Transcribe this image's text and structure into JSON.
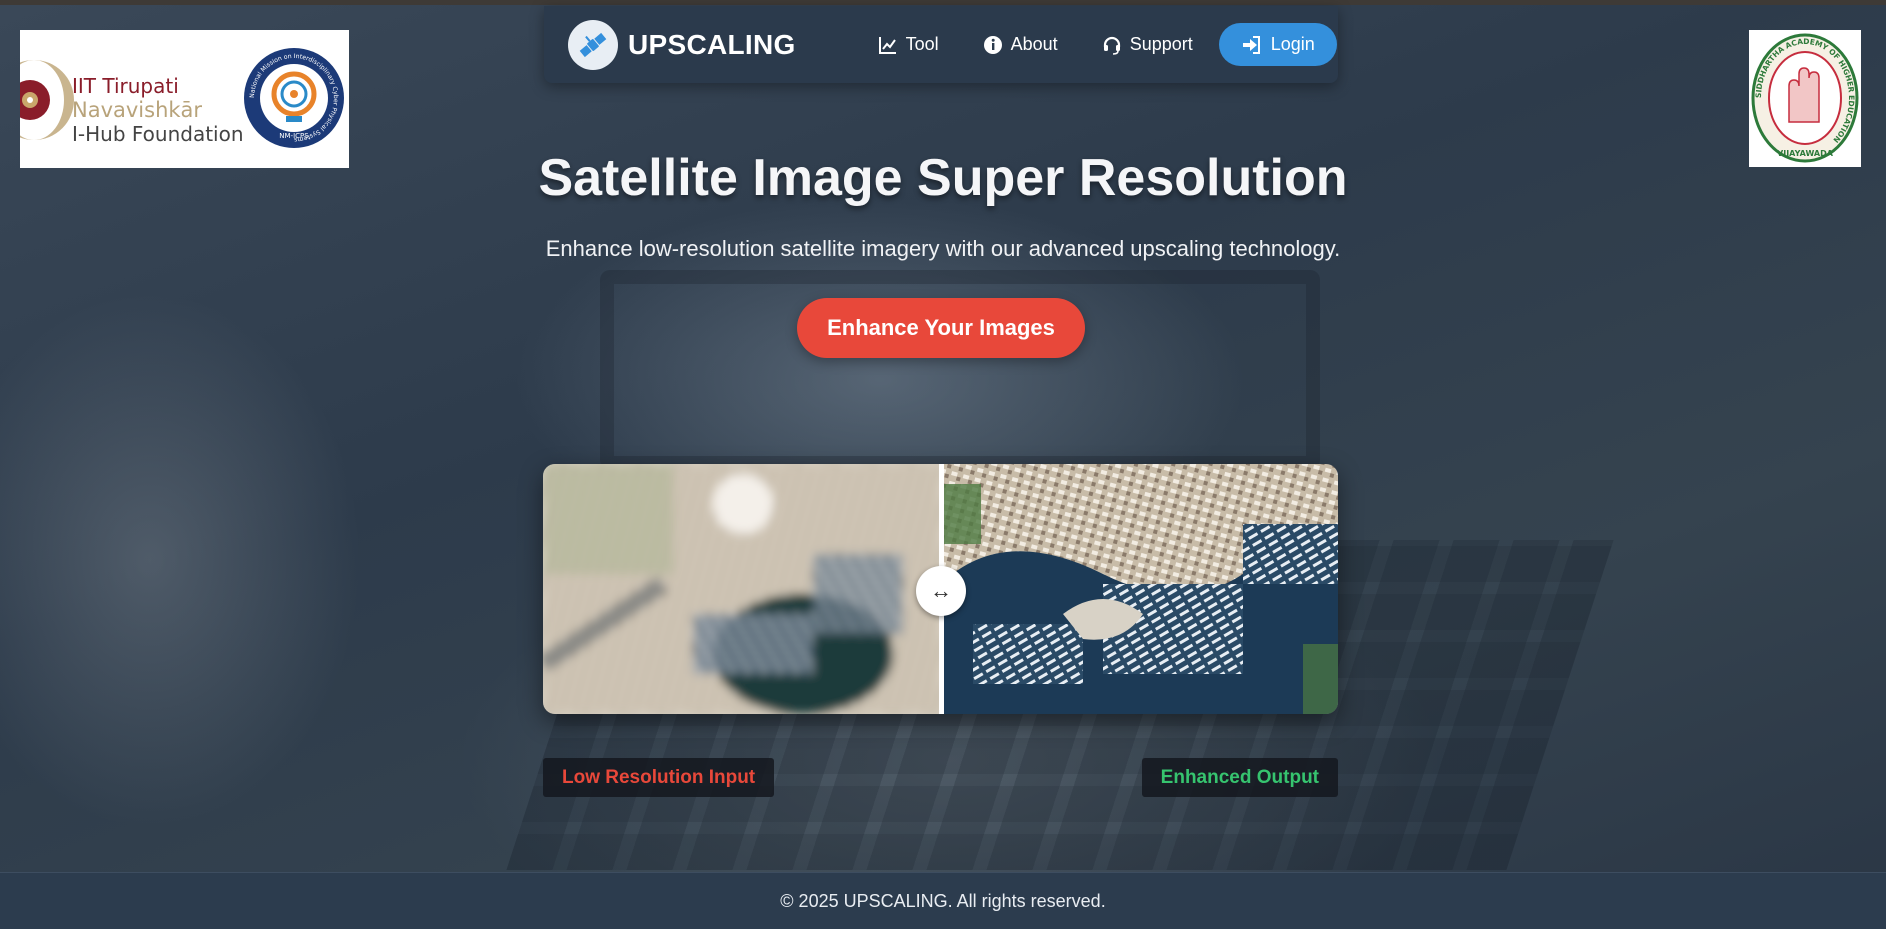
{
  "brand": {
    "name": "UPSCALING",
    "icon": "satellite-icon"
  },
  "nav": {
    "links": [
      {
        "label": "Tool",
        "icon": "chart-line-icon"
      },
      {
        "label": "About",
        "icon": "info-circle-icon"
      },
      {
        "label": "Support",
        "icon": "headset-icon"
      }
    ],
    "login": {
      "label": "Login",
      "icon": "sign-in-icon"
    }
  },
  "partner_left": {
    "line1": "IIT Tirupati",
    "line2": "Navavishkār",
    "line3": "I-Hub Foundation",
    "seal_text": "National Mission on Interdisciplinary Cyber Physical Systems",
    "seal_label": "NM-ICPS"
  },
  "partner_right": {
    "ring_text": "SIDDHARTHA ACADEMY OF HIGHER EDUCATION",
    "city": "VIJAYAWADA"
  },
  "hero": {
    "title": "Satellite Image Super Resolution",
    "subtitle": "Enhance low-resolution satellite imagery with our advanced upscaling technology.",
    "cta": "Enhance Your Images"
  },
  "comparison": {
    "handle_glyph": "↔",
    "left_label": "Low Resolution Input",
    "right_label": "Enhanced Output",
    "position": 0.5
  },
  "footer": {
    "text": "© 2025 UPSCALING. All rights reserved."
  },
  "colors": {
    "accent": "#e8483a",
    "primary": "#3490dc",
    "success": "#36c46f",
    "navbar": "#2b3a4c"
  }
}
